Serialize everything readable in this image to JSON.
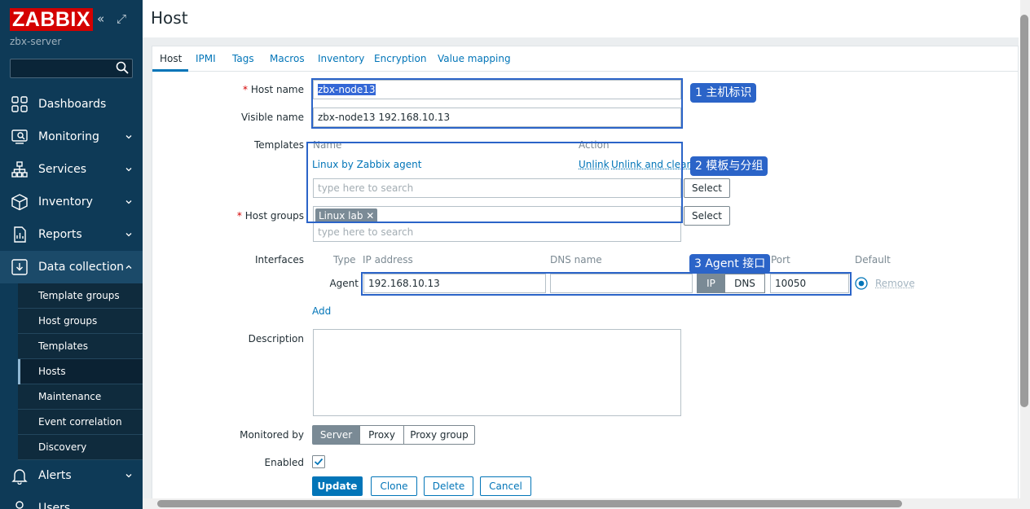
{
  "sidebar": {
    "logo": "ZABBIX",
    "server": "zbx-server",
    "collapse_icon": "«",
    "expand_icon": "⤢",
    "nav": [
      {
        "label": "Dashboards",
        "icon": "dashboard-icon"
      },
      {
        "label": "Monitoring",
        "icon": "monitoring-icon"
      },
      {
        "label": "Services",
        "icon": "services-icon"
      },
      {
        "label": "Inventory",
        "icon": "inventory-icon"
      },
      {
        "label": "Reports",
        "icon": "reports-icon"
      },
      {
        "label": "Data collection",
        "icon": "data-collection-icon"
      },
      {
        "label": "Alerts",
        "icon": "alerts-icon"
      },
      {
        "label": "Users",
        "icon": "users-icon"
      }
    ],
    "sub": [
      "Template groups",
      "Host groups",
      "Templates",
      "Hosts",
      "Maintenance",
      "Event correlation",
      "Discovery"
    ],
    "active_sub": "Hosts"
  },
  "page": {
    "title": "Host"
  },
  "tabs": [
    "Host",
    "IPMI",
    "Tags",
    "Macros",
    "Inventory",
    "Encryption",
    "Value mapping"
  ],
  "form": {
    "host_name_label": "Host name",
    "host_name": "zbx-node13",
    "visible_name_label": "Visible name",
    "visible_name": "zbx-node13 192.168.10.13",
    "templates_label": "Templates",
    "templates_hdr_name": "Name",
    "templates_hdr_action": "Action",
    "template_item": "Linux by Zabbix agent",
    "unlink": "Unlink",
    "unlink_clear": "Unlink and clear",
    "search_placeholder": "type here to search",
    "select": "Select",
    "host_groups_label": "Host groups",
    "host_group_tag": "Linux lab",
    "interfaces_label": "Interfaces",
    "if_type_hdr": "Type",
    "if_ip_hdr": "IP address",
    "if_dns_hdr": "DNS name",
    "if_port_hdr": "Port",
    "if_default_hdr": "Default",
    "if_type": "Agent",
    "if_ip": "192.168.10.13",
    "if_dns": "",
    "if_conn_ip": "IP",
    "if_conn_dns": "DNS",
    "if_port": "10050",
    "remove": "Remove",
    "add": "Add",
    "description_label": "Description",
    "monitored_by_label": "Monitored by",
    "monitored_options": [
      "Server",
      "Proxy",
      "Proxy group"
    ],
    "enabled_label": "Enabled",
    "buttons": {
      "update": "Update",
      "clone": "Clone",
      "delete": "Delete",
      "cancel": "Cancel"
    }
  },
  "annotations": [
    "1 主机标识",
    "2 模板与分组",
    "3 Agent 接口"
  ],
  "colors": {
    "sidebar": "#0e3a57",
    "accent": "#0275b8",
    "annotation": "#2b64c8",
    "logo": "#d40000"
  }
}
